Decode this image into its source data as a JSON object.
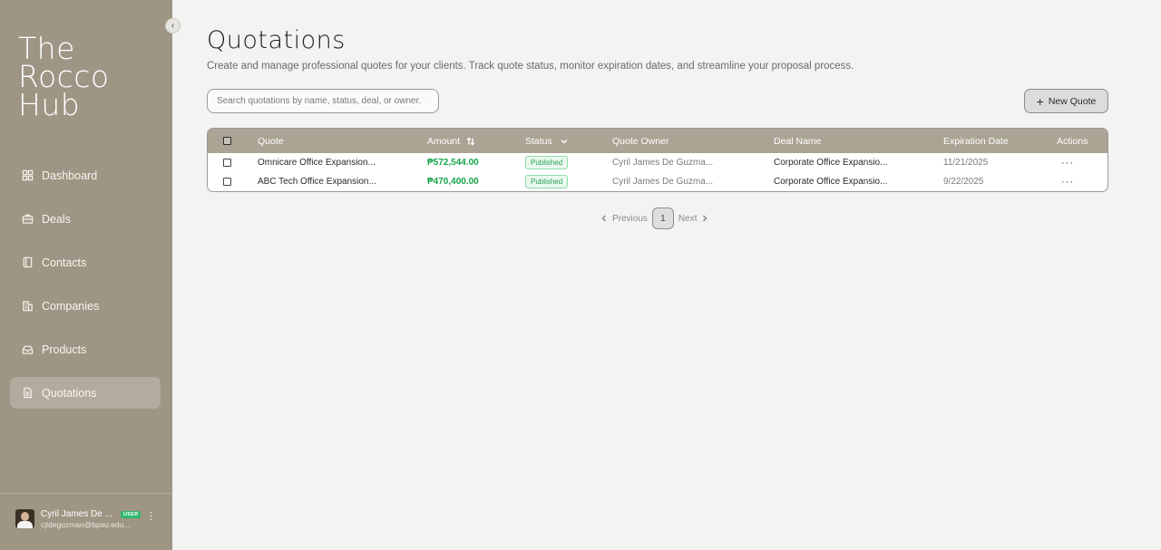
{
  "sidebar": {
    "brand": [
      "The",
      "Rocco",
      "Hub"
    ],
    "items": [
      {
        "label": "Dashboard",
        "icon": "dashboard-icon",
        "active": false
      },
      {
        "label": "Deals",
        "icon": "briefcase-icon",
        "active": false
      },
      {
        "label": "Contacts",
        "icon": "contacts-book-icon",
        "active": false
      },
      {
        "label": "Companies",
        "icon": "building-icon",
        "active": false
      },
      {
        "label": "Products",
        "icon": "package-icon",
        "active": false
      },
      {
        "label": "Quotations",
        "icon": "document-icon",
        "active": true
      }
    ],
    "user": {
      "name": "Cyril James De ...",
      "badge": "USER",
      "email": "cjldeguzman@bpsu.edu..."
    }
  },
  "header": {
    "title": "Quotations",
    "description": "Create and manage professional quotes for your clients. Track quote status, monitor expiration dates, and streamline your proposal process."
  },
  "search": {
    "placeholder": "Search quotations by name, status, deal, or owner."
  },
  "toolbar": {
    "new_quote_label": "New Quote"
  },
  "table": {
    "columns": [
      "Quote",
      "Amount",
      "Status",
      "Quote Owner",
      "Deal Name",
      "Expiration Date",
      "Actions"
    ],
    "rows": [
      {
        "quote": "Omnicare Office Expansion...",
        "amount": "₱572,544.00",
        "status": "Published",
        "owner": "Cyril James De Guzma...",
        "deal": "Corporate Office Expansio...",
        "expiration": "11/21/2025",
        "actions": "···"
      },
      {
        "quote": "ABC Tech Office Expansion...",
        "amount": "₱470,400.00",
        "status": "Published",
        "owner": "Cyril James De Guzma...",
        "deal": "Corporate Office Expansio...",
        "expiration": "9/22/2025",
        "actions": "···"
      }
    ]
  },
  "pagination": {
    "previous_label": "Previous",
    "current_page": "1",
    "next_label": "Next"
  },
  "colors": {
    "sidebar_bg": "#9f9584",
    "table_header_bg": "#aba394",
    "amount_green": "#17a34a",
    "badge_green": "#27a457"
  }
}
